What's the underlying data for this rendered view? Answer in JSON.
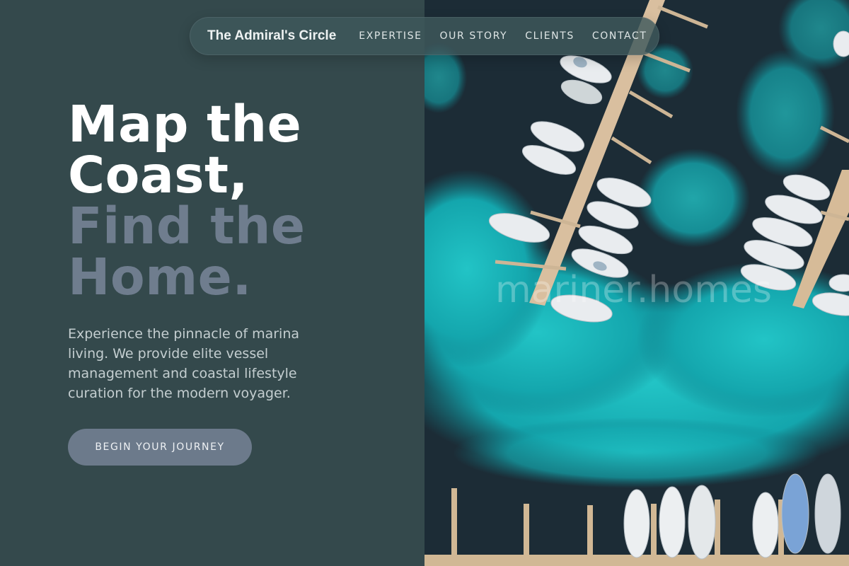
{
  "nav": {
    "brand": "The Admiral's Circle",
    "links": [
      "EXPERTISE",
      "OUR STORY",
      "CLIENTS",
      "CONTACT"
    ]
  },
  "hero": {
    "line1": "Map the",
    "line2": "Coast,",
    "line3": "Find the",
    "line4": "Home.",
    "subtitle": "Experience the pinnacle of marina living. We provide elite vessel management and coastal lifestyle curation for the modern voyager.",
    "cta_label": "BEGIN YOUR JOURNEY"
  },
  "image": {
    "watermark": "mariner.homes",
    "alt": "Aerial view of a marina with white yachts moored along wooden piers over turquoise water"
  },
  "colors": {
    "panel_bg": "#34494c",
    "headline_light": "#ffffff",
    "headline_muted": "#6f7d8e",
    "button_bg": "#6c7a8b",
    "water_deep": "#1d2d36",
    "water_turquoise": "#17b3b8"
  }
}
